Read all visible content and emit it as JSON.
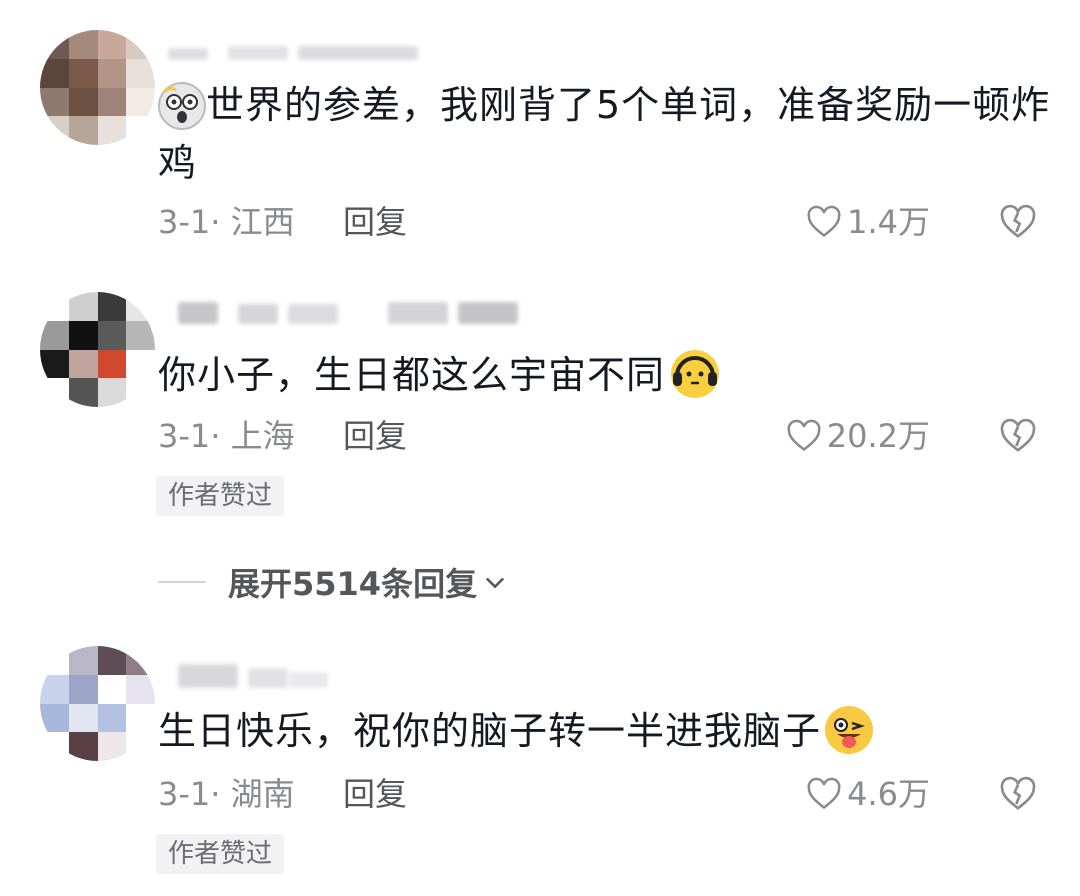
{
  "comments": [
    {
      "text_before_emoji": "",
      "text": "世界的参差，我刚背了5个单词，准备奖励一顿炸鸡",
      "date_location": "3-1· 江西",
      "reply_label": "回复",
      "likes": "1.4万",
      "emoji": "scared-face",
      "author_liked": ""
    },
    {
      "text": "你小子，生日都这么宇宙不同",
      "date_location": "3-1· 上海",
      "reply_label": "回复",
      "likes": "20.2万",
      "emoji": "headphones-face",
      "author_liked": "作者赞过"
    },
    {
      "text": "生日快乐，祝你的脑子转一半进我脑子",
      "date_location": "3-1· 湖南",
      "reply_label": "回复",
      "likes": "4.6万",
      "emoji": "wink-tongue-face",
      "author_liked": "作者赞过"
    }
  ],
  "expand_replies": "展开5514条回复",
  "icons": {
    "like": "heart-outline-icon",
    "dislike": "broken-heart-icon",
    "expand": "chevron-down-icon"
  },
  "colors": {
    "text": "#161823",
    "muted": "#8a8b91",
    "reply": "#55565c",
    "badge_bg": "#f2f2f4"
  }
}
